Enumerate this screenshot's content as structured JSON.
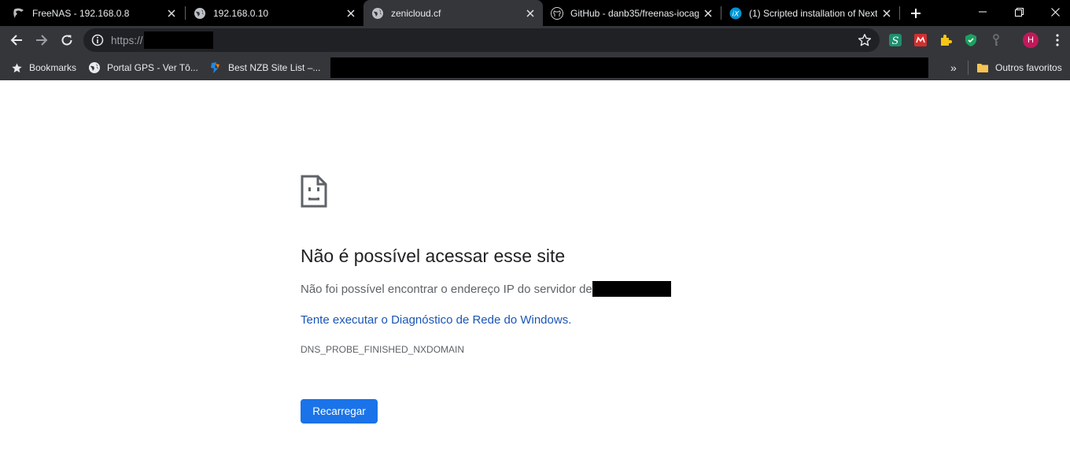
{
  "tabs": [
    {
      "title": "FreeNAS - 192.168.0.8",
      "icon": "freenas-icon",
      "active": false
    },
    {
      "title": "192.168.0.10",
      "icon": "globe-icon",
      "active": false
    },
    {
      "title": "zenicloud.cf",
      "icon": "globe-icon",
      "active": true
    },
    {
      "title": "GitHub - danb35/freenas-iocag",
      "icon": "github-icon",
      "active": false
    },
    {
      "title": "(1) Scripted installation of Next",
      "icon": "ix-icon",
      "active": false
    }
  ],
  "toolbar": {
    "url": "https://"
  },
  "bookmarks": {
    "items": [
      {
        "label": "Bookmarks",
        "icon": "star-icon"
      },
      {
        "label": "Portal GPS - Ver Tô...",
        "icon": "gps-icon"
      },
      {
        "label": "Best NZB Site List –...",
        "icon": "nzb-icon"
      }
    ],
    "other_label": "Outros favoritos"
  },
  "error": {
    "title": "Não é possível acessar esse site",
    "description": "Não foi possível encontrar o endereço IP do servidor de",
    "link": "Tente executar o Diagnóstico de Rede do Windows.",
    "code": "DNS_PROBE_FINISHED_NXDOMAIN",
    "button": "Recarregar"
  },
  "avatar_initial": "H",
  "colors": {
    "tab_strip": "#000000",
    "toolbar": "#35363a",
    "omnibox": "#202124",
    "link": "#1a55b5",
    "button": "#1a73e8",
    "avatar": "#c2185b"
  }
}
